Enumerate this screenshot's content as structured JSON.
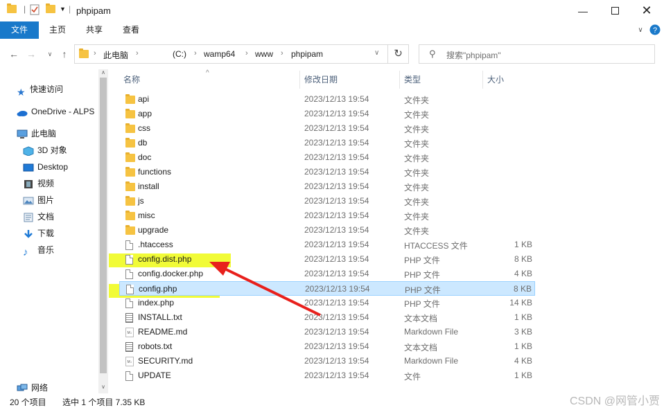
{
  "title": "phpipam",
  "ribbon": {
    "tabs": [
      "文件",
      "主页",
      "共享",
      "查看"
    ]
  },
  "address": {
    "crumbs": [
      "此电脑",
      "(C:)",
      "wamp64",
      "www",
      "phpipam"
    ]
  },
  "search": {
    "placeholder": "搜索\"phpipam\""
  },
  "nav": {
    "quick_access": "快速访问",
    "onedrive": "OneDrive - ALPS",
    "this_pc": "此电脑",
    "objects3d": "3D 对象",
    "desktop": "Desktop",
    "videos": "视频",
    "pictures": "图片",
    "documents": "文档",
    "downloads": "下载",
    "music": "音乐",
    "network": "网络"
  },
  "columns": {
    "name": "名称",
    "date": "修改日期",
    "type": "类型",
    "size": "大小"
  },
  "files": [
    {
      "name": "api",
      "date": "2023/12/13 19:54",
      "type": "文件夹",
      "size": "",
      "kind": "folder"
    },
    {
      "name": "app",
      "date": "2023/12/13 19:54",
      "type": "文件夹",
      "size": "",
      "kind": "folder"
    },
    {
      "name": "css",
      "date": "2023/12/13 19:54",
      "type": "文件夹",
      "size": "",
      "kind": "folder"
    },
    {
      "name": "db",
      "date": "2023/12/13 19:54",
      "type": "文件夹",
      "size": "",
      "kind": "folder"
    },
    {
      "name": "doc",
      "date": "2023/12/13 19:54",
      "type": "文件夹",
      "size": "",
      "kind": "folder"
    },
    {
      "name": "functions",
      "date": "2023/12/13 19:54",
      "type": "文件夹",
      "size": "",
      "kind": "folder"
    },
    {
      "name": "install",
      "date": "2023/12/13 19:54",
      "type": "文件夹",
      "size": "",
      "kind": "folder"
    },
    {
      "name": "js",
      "date": "2023/12/13 19:54",
      "type": "文件夹",
      "size": "",
      "kind": "folder"
    },
    {
      "name": "misc",
      "date": "2023/12/13 19:54",
      "type": "文件夹",
      "size": "",
      "kind": "folder"
    },
    {
      "name": "upgrade",
      "date": "2023/12/13 19:54",
      "type": "文件夹",
      "size": "",
      "kind": "folder"
    },
    {
      "name": ".htaccess",
      "date": "2023/12/13 19:54",
      "type": "HTACCESS 文件",
      "size": "1 KB",
      "kind": "file"
    },
    {
      "name": "config.dist.php",
      "date": "2023/12/13 19:54",
      "type": "PHP 文件",
      "size": "8 KB",
      "kind": "file"
    },
    {
      "name": "config.docker.php",
      "date": "2023/12/13 19:54",
      "type": "PHP 文件",
      "size": "4 KB",
      "kind": "file"
    },
    {
      "name": "config.php",
      "date": "2023/12/13 19:54",
      "type": "PHP 文件",
      "size": "8 KB",
      "kind": "file"
    },
    {
      "name": "index.php",
      "date": "2023/12/13 19:54",
      "type": "PHP 文件",
      "size": "14 KB",
      "kind": "file"
    },
    {
      "name": "INSTALL.txt",
      "date": "2023/12/13 19:54",
      "type": "文本文档",
      "size": "1 KB",
      "kind": "txt"
    },
    {
      "name": "README.md",
      "date": "2023/12/13 19:54",
      "type": "Markdown File",
      "size": "3 KB",
      "kind": "md"
    },
    {
      "name": "robots.txt",
      "date": "2023/12/13 19:54",
      "type": "文本文档",
      "size": "1 KB",
      "kind": "txt"
    },
    {
      "name": "SECURITY.md",
      "date": "2023/12/13 19:54",
      "type": "Markdown File",
      "size": "4 KB",
      "kind": "md"
    },
    {
      "name": "UPDATE",
      "date": "2023/12/13 19:54",
      "type": "文件",
      "size": "1 KB",
      "kind": "file"
    }
  ],
  "status": {
    "count": "20 个项目",
    "selection": "选中 1 个项目  7.35 KB"
  },
  "watermark": "CSDN @网管小贾",
  "colors": {
    "accent": "#1979ca",
    "folder": "#f6c342",
    "highlight": "#eefa14",
    "arrow": "#e8201c",
    "selection": "#cce8ff"
  }
}
